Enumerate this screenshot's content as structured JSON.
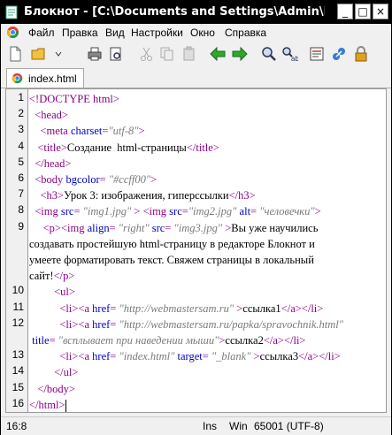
{
  "titlebar": {
    "title": "Блокнот - [C:\\Documents and Settings\\Admin\\Мои докум...",
    "minimize_label": "_",
    "maximize_label": "□",
    "close_label": "×"
  },
  "menu": {
    "items": [
      "Файл",
      "Правка",
      "Вид",
      "Настройки",
      "Окно",
      "Справка"
    ]
  },
  "tab": {
    "label": "index.html"
  },
  "editor": {
    "line_numbers": [
      "1",
      "2",
      "3",
      "4",
      "5",
      "6",
      "7",
      "8",
      "9",
      "",
      "",
      "",
      "10",
      "11",
      "12",
      "",
      "13",
      "14",
      "15",
      "16"
    ],
    "lines": [
      [
        {
          "t": "<!DOCTYPE html>",
          "c": "tag"
        }
      ],
      [
        {
          "t": "  <head>",
          "c": "tag"
        }
      ],
      [
        {
          "t": "    <meta ",
          "c": "tag"
        },
        {
          "t": "charset",
          "c": "attr"
        },
        {
          "t": "=",
          "c": "tag"
        },
        {
          "t": "\"utf-8\"",
          "c": "val"
        },
        {
          "t": ">",
          "c": "tag"
        }
      ],
      [
        {
          "t": "   <title>",
          "c": "tag"
        },
        {
          "t": "Создание  html-страницы",
          "c": "txt"
        },
        {
          "t": "</title>",
          "c": "tag"
        }
      ],
      [
        {
          "t": "  </head>",
          "c": "tag"
        }
      ],
      [
        {
          "t": "  <body ",
          "c": "tag"
        },
        {
          "t": "bgcolor",
          "c": "attr"
        },
        {
          "t": "= ",
          "c": "tag"
        },
        {
          "t": "\"#ccff00\"",
          "c": "val"
        },
        {
          "t": ">",
          "c": "tag"
        }
      ],
      [
        {
          "t": "    <h3>",
          "c": "tag"
        },
        {
          "t": "Урок 3: изображения, гиперссылки",
          "c": "txt"
        },
        {
          "t": "</h3>",
          "c": "tag"
        }
      ],
      [
        {
          "t": "  <img ",
          "c": "tag"
        },
        {
          "t": "src",
          "c": "attr"
        },
        {
          "t": "= ",
          "c": "tag"
        },
        {
          "t": "\"img1.jpg\"",
          "c": "val"
        },
        {
          "t": " > <img ",
          "c": "tag"
        },
        {
          "t": "src",
          "c": "attr"
        },
        {
          "t": "=",
          "c": "tag"
        },
        {
          "t": "\"img2.jpg\"",
          "c": "val"
        },
        {
          "t": " alt",
          "c": "attr"
        },
        {
          "t": "= ",
          "c": "tag"
        },
        {
          "t": "\"человечки\"",
          "c": "val"
        },
        {
          "t": ">",
          "c": "tag"
        }
      ],
      [
        {
          "t": "     <p><img ",
          "c": "tag"
        },
        {
          "t": "align",
          "c": "attr"
        },
        {
          "t": "= ",
          "c": "tag"
        },
        {
          "t": "\"right\"",
          "c": "val"
        },
        {
          "t": " src",
          "c": "attr"
        },
        {
          "t": "= ",
          "c": "tag"
        },
        {
          "t": "\"img3.jpg\"",
          "c": "val"
        },
        {
          "t": " >",
          "c": "tag"
        },
        {
          "t": "Вы уже научились",
          "c": "txt"
        }
      ],
      [
        {
          "t": "создавать простейшую html-страницу в редакторе Блокнот и",
          "c": "txt"
        }
      ],
      [
        {
          "t": "умеете форматировать текст. Свяжем страницы в локальный",
          "c": "txt"
        }
      ],
      [
        {
          "t": "сайт!",
          "c": "txt"
        },
        {
          "t": "</p>",
          "c": "tag"
        }
      ],
      [
        {
          "t": "         <ul>",
          "c": "tag"
        }
      ],
      [
        {
          "t": "           <li><a ",
          "c": "tag"
        },
        {
          "t": "href",
          "c": "attr"
        },
        {
          "t": "= ",
          "c": "tag"
        },
        {
          "t": "\"http://webmastersam.ru\"",
          "c": "val"
        },
        {
          "t": " >",
          "c": "tag"
        },
        {
          "t": "ссылка1",
          "c": "txt"
        },
        {
          "t": "</a></li>",
          "c": "tag"
        }
      ],
      [
        {
          "t": "           <li><a ",
          "c": "tag"
        },
        {
          "t": "href",
          "c": "attr"
        },
        {
          "t": "= ",
          "c": "tag"
        },
        {
          "t": "\"http://webmastersam.ru/papka/spravochnik.html\"",
          "c": "val"
        }
      ],
      [
        {
          "t": " title",
          "c": "attr"
        },
        {
          "t": "= ",
          "c": "tag"
        },
        {
          "t": "\"всплывает при наведении мыши\"",
          "c": "val"
        },
        {
          "t": ">",
          "c": "tag"
        },
        {
          "t": "ссылка2",
          "c": "txt"
        },
        {
          "t": "</a></li>",
          "c": "tag"
        }
      ],
      [
        {
          "t": "           <li><a ",
          "c": "tag"
        },
        {
          "t": "href",
          "c": "attr"
        },
        {
          "t": "= ",
          "c": "tag"
        },
        {
          "t": "\"index.html\"",
          "c": "val"
        },
        {
          "t": " target",
          "c": "attr"
        },
        {
          "t": "= ",
          "c": "tag"
        },
        {
          "t": "\"_blank\"",
          "c": "val"
        },
        {
          "t": " >",
          "c": "tag"
        },
        {
          "t": "ссылка3",
          "c": "txt"
        },
        {
          "t": "</a></li>",
          "c": "tag"
        }
      ],
      [
        {
          "t": "         </ul>",
          "c": "tag"
        }
      ],
      [
        {
          "t": "   </body>",
          "c": "tag"
        }
      ],
      [
        {
          "t": "</html>",
          "c": "tag"
        }
      ]
    ]
  },
  "status": {
    "position": "16:8",
    "mode": "Ins",
    "eol": "Win",
    "encoding": "65001 (UTF-8)"
  },
  "colors": {
    "tag": "#8b0088",
    "attr": "#0000cc",
    "value": "#7a7a7a",
    "titlebar": "#000000"
  },
  "toolbar_icons": [
    "new-file-icon",
    "open-folder-icon",
    "save-icon",
    "print-icon",
    "print-preview-icon",
    "cut-icon",
    "copy-icon",
    "paste-icon",
    "back-arrow-icon",
    "forward-arrow-icon",
    "find-icon",
    "replace-icon",
    "show-list-icon",
    "plugin-icon",
    "lock-icon"
  ]
}
